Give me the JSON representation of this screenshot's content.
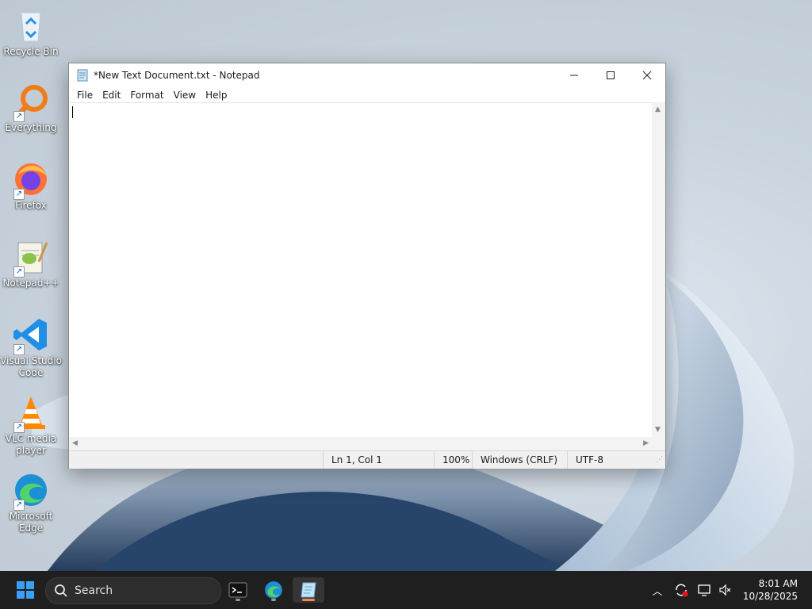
{
  "desktop": {
    "icons": [
      {
        "label": "Recycle Bin",
        "icon": "recycle-bin-icon"
      },
      {
        "label": "Everything",
        "icon": "everything-search-icon"
      },
      {
        "label": "Firefox",
        "icon": "firefox-icon"
      },
      {
        "label": "Notepad++",
        "icon": "notepadpp-icon"
      },
      {
        "label": "Visual Studio Code",
        "icon": "vscode-icon"
      },
      {
        "label": "VLC media player",
        "icon": "vlc-icon"
      },
      {
        "label": "Microsoft Edge",
        "icon": "edge-icon"
      }
    ]
  },
  "window": {
    "title": "*New Text Document.txt - Notepad",
    "menu": [
      "File",
      "Edit",
      "Format",
      "View",
      "Help"
    ],
    "content": "",
    "status": {
      "position": "Ln 1, Col 1",
      "zoom": "100%",
      "line_ending": "Windows (CRLF)",
      "encoding": "UTF-8"
    }
  },
  "taskbar": {
    "search_placeholder": "Search",
    "pinned": [
      "terminal-icon",
      "edge-icon",
      "notepad-icon"
    ],
    "clock": {
      "time": "8:01 AM",
      "date": "10/28/2025"
    }
  },
  "colors": {
    "taskbar_bg": "#1f1f1f",
    "active_indicator": "#f08a5d",
    "windows_blue": "#0078d4"
  }
}
